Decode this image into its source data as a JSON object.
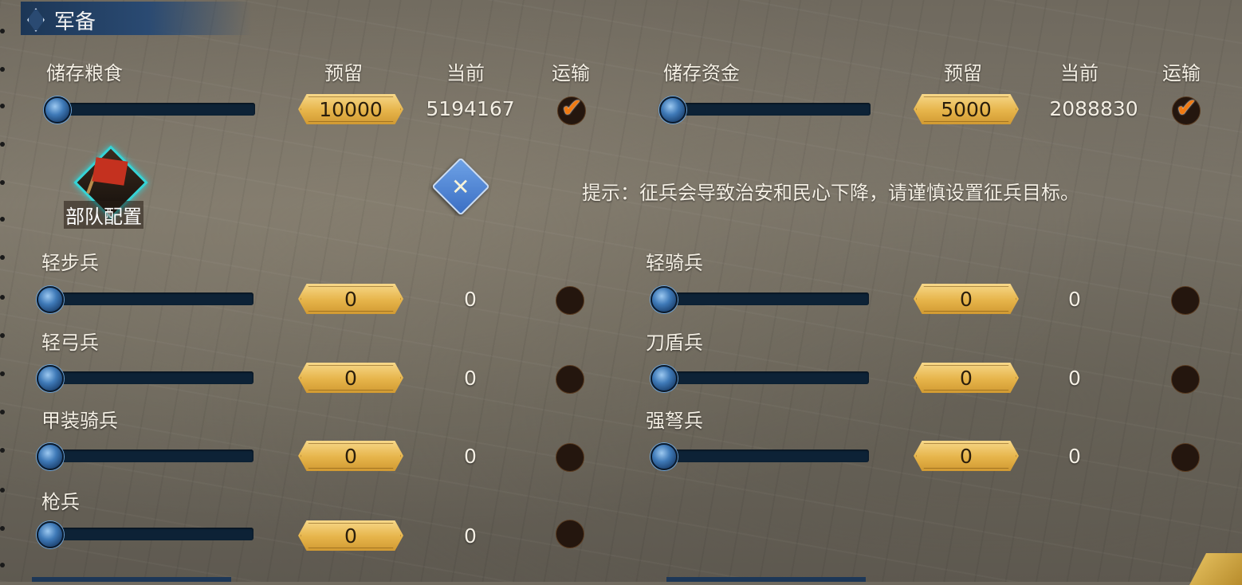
{
  "section": {
    "title": "军备"
  },
  "headers": {
    "food": "储存粮食",
    "funds": "储存资金",
    "reserve": "预留",
    "current": "当前",
    "transport": "运输"
  },
  "resources": {
    "food": {
      "reserve": "10000",
      "current": "5194167",
      "transport": true
    },
    "funds": {
      "reserve": "5000",
      "current": "2088830",
      "transport": true
    }
  },
  "troop_config": {
    "label": "部队配置"
  },
  "hint": "提示：征兵会导致治安和民心下降，请谨慎设置征兵目标。",
  "troops": {
    "light_infantry": {
      "name": "轻步兵",
      "reserve": "0",
      "current": "0"
    },
    "light_cavalry": {
      "name": "轻骑兵",
      "reserve": "0",
      "current": "0"
    },
    "light_archer": {
      "name": "轻弓兵",
      "reserve": "0",
      "current": "0"
    },
    "sword_shield": {
      "name": "刀盾兵",
      "reserve": "0",
      "current": "0"
    },
    "armored_cavalry": {
      "name": "甲装骑兵",
      "reserve": "0",
      "current": "0"
    },
    "crossbow": {
      "name": "强弩兵",
      "reserve": "0",
      "current": "0"
    },
    "spear": {
      "name": "枪兵",
      "reserve": "0",
      "current": "0"
    }
  },
  "icons": {
    "check": "✔",
    "tool": "✕"
  },
  "colors": {
    "header_bg": "#1c3656",
    "value_box": "#e6b44a",
    "slider_track": "#0d2236",
    "checkmark": "#f07a12",
    "troop_icon_glow": "#35d3d6"
  }
}
